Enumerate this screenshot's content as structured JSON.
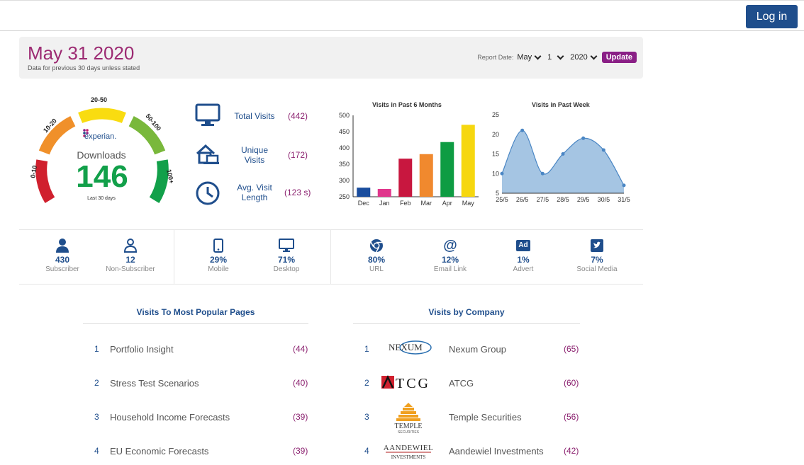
{
  "topbar": {
    "login_label": "Log in"
  },
  "header": {
    "date": "May 31 2020",
    "subtitle": "Data for previous 30 days unless stated",
    "report_label": "Report Date:",
    "month": "May",
    "day": "1",
    "year": "2020",
    "update_label": "Update"
  },
  "gauge": {
    "brand": "experian.",
    "title": "Downloads",
    "value": "146",
    "caption": "Last 30 days",
    "segments": [
      "0-10",
      "10-20",
      "20-50",
      "50-100",
      "100+"
    ],
    "colors": [
      "#d0202e",
      "#f0902a",
      "#f9dc10",
      "#79b83b",
      "#12a04a"
    ]
  },
  "metrics": [
    {
      "icon": "monitor-icon",
      "label_1": "Total Visits",
      "label_2": "",
      "value": "(442)"
    },
    {
      "icon": "home-devices-icon",
      "label_1": "Unique",
      "label_2": "Visits",
      "value": "(172)"
    },
    {
      "icon": "clock-icon",
      "label_1": "Avg. Visit",
      "label_2": "Length",
      "value": "(123 s)"
    }
  ],
  "chart_data": [
    {
      "type": "bar",
      "title": "Visits in Past 6 Months",
      "categories": [
        "Dec",
        "Jan",
        "Feb",
        "Mar",
        "Apr",
        "May"
      ],
      "values": [
        278,
        274,
        367,
        381,
        418,
        471
      ],
      "colors": [
        "#1a4d9e",
        "#e0368c",
        "#c8173f",
        "#f0892e",
        "#0e9c43",
        "#f6d70f"
      ],
      "ylim": [
        250,
        500
      ],
      "yticks": [
        "500",
        "450",
        "400",
        "350",
        "300",
        "250"
      ],
      "grid": false
    },
    {
      "type": "area",
      "title": "Visits in Past Week",
      "categories": [
        "25/5",
        "26/5",
        "27/5",
        "28/5",
        "29/5",
        "30/5",
        "31/5"
      ],
      "values": [
        10,
        21,
        10,
        15,
        19,
        16,
        7
      ],
      "ylim": [
        5,
        25
      ],
      "yticks": [
        "25",
        "20",
        "15",
        "10",
        "5"
      ],
      "color": "#9bbfe0",
      "grid": false
    }
  ],
  "stats": [
    {
      "icon": "user-icon",
      "value": "430",
      "label": "Subscriber"
    },
    {
      "icon": "user-outline-icon",
      "value": "12",
      "label": "Non-Subscriber"
    },
    {
      "icon": "mobile-icon",
      "value": "29%",
      "label": "Mobile"
    },
    {
      "icon": "desktop-icon",
      "value": "71%",
      "label": "Desktop"
    },
    {
      "icon": "chrome-icon",
      "value": "80%",
      "label": "URL"
    },
    {
      "icon": "at-icon",
      "value": "12%",
      "label": "Email Link"
    },
    {
      "icon": "ad-icon",
      "value": "1%",
      "label": "Advert"
    },
    {
      "icon": "twitter-icon",
      "value": "7%",
      "label": "Social Media"
    }
  ],
  "popular_pages": {
    "title": "Visits To Most Popular Pages",
    "rows": [
      {
        "rank": "1",
        "name": "Portfolio Insight",
        "count": "(44)"
      },
      {
        "rank": "2",
        "name": "Stress Test Scenarios",
        "count": "(40)"
      },
      {
        "rank": "3",
        "name": "Household Income Forecasts",
        "count": "(39)"
      },
      {
        "rank": "4",
        "name": "EU Economic Forecasts",
        "count": "(39)"
      }
    ]
  },
  "companies": {
    "title": "Visits by Company",
    "rows": [
      {
        "rank": "1",
        "logo": "NEXUM",
        "name": "Nexum Group",
        "count": "(65)"
      },
      {
        "rank": "2",
        "logo": "TCG",
        "name": "ATCG",
        "count": "(60)"
      },
      {
        "rank": "3",
        "logo": "TEMPLE",
        "logo_sub": "SECURITIES",
        "name": "Temple Securities",
        "count": "(56)"
      },
      {
        "rank": "4",
        "logo": "AANDEWIEL",
        "logo_sub": "INVESTMENTS",
        "name": "Aandewiel Investments",
        "count": "(42)"
      }
    ]
  }
}
